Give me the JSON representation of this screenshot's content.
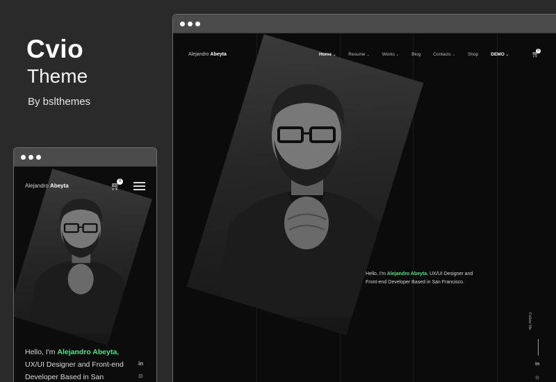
{
  "promo": {
    "title": "Cvio",
    "subtitle": "Theme",
    "byline": "By bslthemes"
  },
  "desktop": {
    "logo_first": "Alejandro",
    "logo_last": "Abeyta",
    "nav": [
      {
        "label": "Home",
        "has_dropdown": true,
        "active": true
      },
      {
        "label": "Resume",
        "has_dropdown": true
      },
      {
        "label": "Works",
        "has_dropdown": true
      },
      {
        "label": "Blog",
        "has_dropdown": false
      },
      {
        "label": "Contacts",
        "has_dropdown": true
      },
      {
        "label": "Shop",
        "has_dropdown": false
      },
      {
        "label": "DEMO",
        "has_dropdown": true
      }
    ],
    "cart_count": "0",
    "hello_prefix": "Hello, I'm ",
    "hello_name": "Alejandro Abeyta",
    "hello_suffix": ", UX/UI Designer and Front-end Developer Based in San Francisco.",
    "follow_label": "Follow Me",
    "social": {
      "linkedin": "in",
      "github": "⊙"
    }
  },
  "mobile": {
    "logo_first": "Alejandro",
    "logo_last": "Abeyta",
    "cart_count": "0",
    "hello_prefix": "Hello, I'm ",
    "hello_name": "Alejandro Abeyta",
    "hello_suffix": ", UX/UI Designer and Front-end Developer Based in San",
    "social": {
      "linkedin": "in",
      "github": "⊙"
    }
  },
  "colors": {
    "accent": "#4ee38b",
    "background": "#2a2a2a",
    "site_background": "#0b0b0b"
  },
  "icons": [
    "cart-icon",
    "chevron-down-icon",
    "hamburger-menu-icon",
    "linkedin-icon",
    "github-icon"
  ]
}
